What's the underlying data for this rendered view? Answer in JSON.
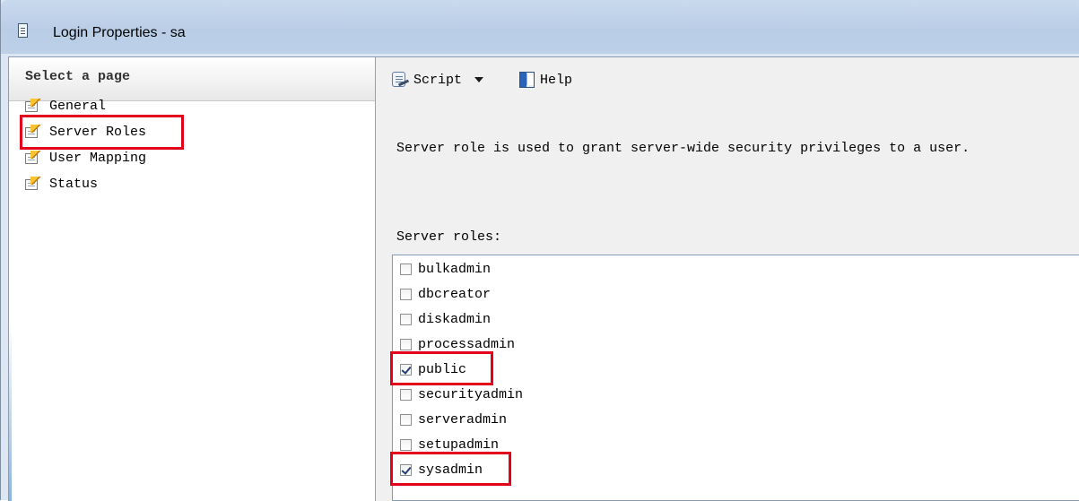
{
  "window": {
    "title": "Login Properties - sa"
  },
  "nav": {
    "header": "Select a page",
    "items": [
      {
        "label": "General",
        "icon": "page-icon",
        "highlighted": false
      },
      {
        "label": "Server Roles",
        "icon": "page-icon",
        "highlighted": true
      },
      {
        "label": "User Mapping",
        "icon": "page-icon",
        "highlighted": false
      },
      {
        "label": "Status",
        "icon": "page-icon",
        "highlighted": false
      }
    ]
  },
  "toolbar": {
    "script_label": "Script",
    "help_label": "Help"
  },
  "main": {
    "description": "Server role is used to grant server-wide security privileges to a user.",
    "roles_label": "Server roles:",
    "roles": [
      {
        "name": "bulkadmin",
        "checked": false,
        "highlighted": false
      },
      {
        "name": "dbcreator",
        "checked": false,
        "highlighted": false
      },
      {
        "name": "diskadmin",
        "checked": false,
        "highlighted": false
      },
      {
        "name": "processadmin",
        "checked": false,
        "highlighted": false
      },
      {
        "name": "public",
        "checked": true,
        "highlighted": true
      },
      {
        "name": "securityadmin",
        "checked": false,
        "highlighted": false
      },
      {
        "name": "serveradmin",
        "checked": false,
        "highlighted": false
      },
      {
        "name": "setupadmin",
        "checked": false,
        "highlighted": false
      },
      {
        "name": "sysadmin",
        "checked": true,
        "highlighted": true
      }
    ]
  },
  "colors": {
    "highlight": "#e3001b",
    "titlebar": "#c9daee"
  }
}
